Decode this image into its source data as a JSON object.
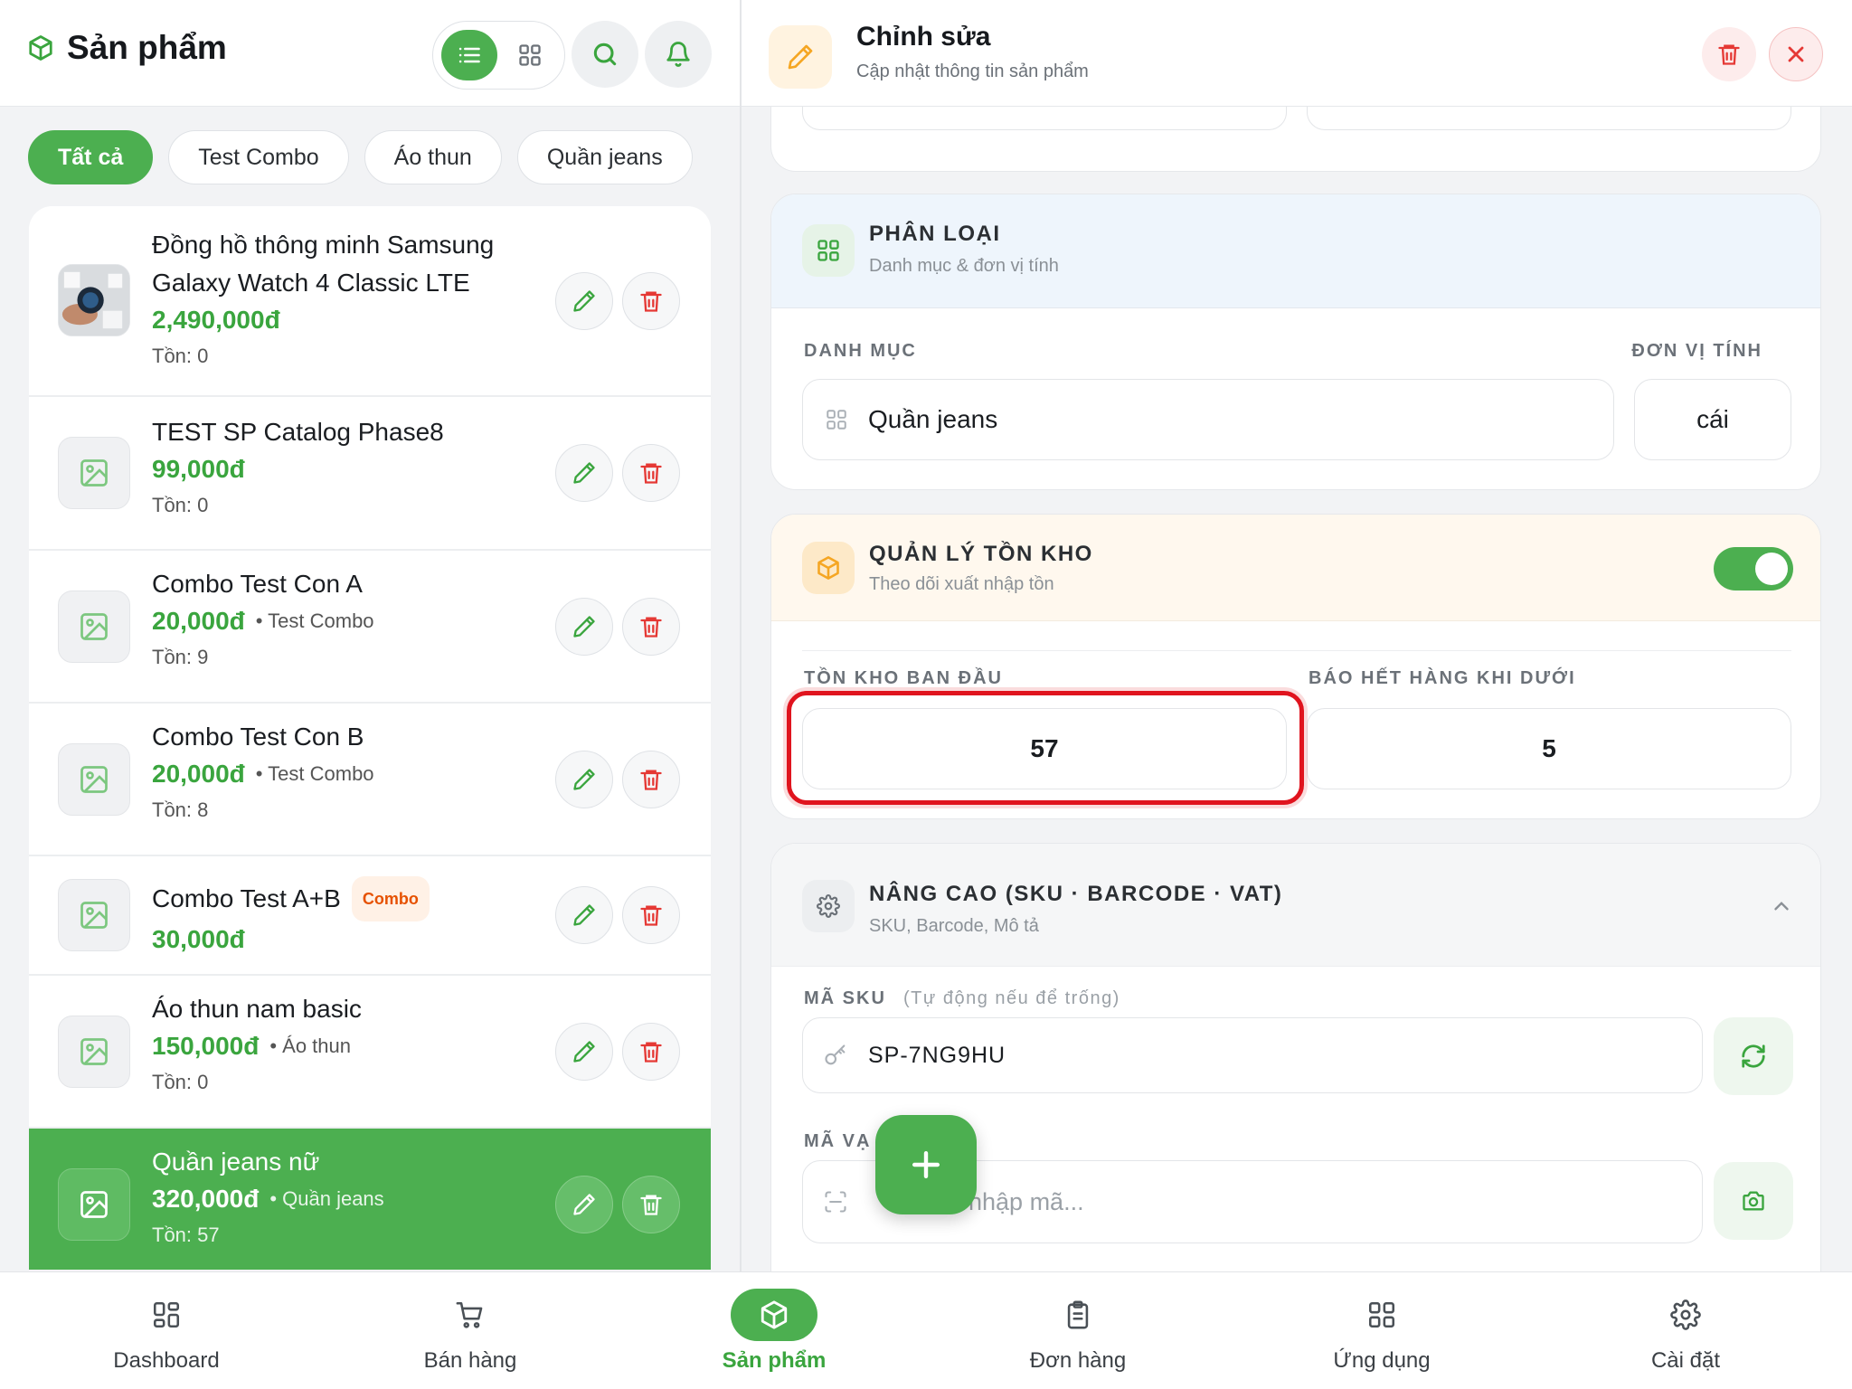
{
  "left": {
    "title": "Sản phẩm",
    "chips": [
      "Tất cả",
      "Test Combo",
      "Áo thun",
      "Quần jeans"
    ],
    "products": [
      {
        "name": "Đồng hồ thông minh Samsung Galaxy Watch 4 Classic LTE",
        "price": "2,490,000đ",
        "category": "",
        "stock": "Tồn: 0",
        "badge": ""
      },
      {
        "name": "TEST SP Catalog Phase8",
        "price": "99,000đ",
        "category": "",
        "stock": "Tồn: 0",
        "badge": ""
      },
      {
        "name": "Combo Test Con A",
        "price": "20,000đ",
        "category": "• Test Combo",
        "stock": "Tồn: 9",
        "badge": ""
      },
      {
        "name": "Combo Test Con B",
        "price": "20,000đ",
        "category": "• Test Combo",
        "stock": "Tồn: 8",
        "badge": ""
      },
      {
        "name": "Combo Test A+B",
        "price": "30,000đ",
        "category": "",
        "stock": "",
        "badge": "Combo"
      },
      {
        "name": "Áo thun nam basic",
        "price": "150,000đ",
        "category": "• Áo thun",
        "stock": "Tồn: 0",
        "badge": ""
      },
      {
        "name": "Quần jeans nữ",
        "price": "320,000đ",
        "category": "• Quần jeans",
        "stock": "Tồn: 57",
        "badge": ""
      }
    ]
  },
  "right": {
    "title": "Chỉnh sửa",
    "subtitle": "Cập nhật thông tin sản phẩm",
    "classification": {
      "title": "PHÂN LOẠI",
      "subtitle": "Danh mục & đơn vị tính",
      "category_label": "DANH MỤC",
      "unit_label": "ĐƠN VỊ TÍNH",
      "category_value": "Quần jeans",
      "unit_value": "cái"
    },
    "inventory": {
      "title": "QUẢN LÝ TỒN KHO",
      "subtitle": "Theo dõi xuất nhập tồn",
      "enabled": true,
      "initial_label": "TỒN KHO BAN ĐẦU",
      "alert_label": "BÁO HẾT HÀNG KHI DƯỚI",
      "initial_value": "57",
      "alert_value": "5"
    },
    "advanced": {
      "title": "NÂNG CAO (SKU · BARCODE · VAT)",
      "subtitle": "SKU, Barcode, Mô tả",
      "sku_label": "MÃ SKU",
      "sku_hint": "(Tự động nếu để trống)",
      "sku_value": "SP-7NG9HU",
      "barcode_label_visible": "MÃ VẠ",
      "barcode_placeholder_visible": "c nhập mã..."
    }
  },
  "nav": [
    "Dashboard",
    "Bán hàng",
    "Sản phẩm",
    "Đơn hàng",
    "Ứng dụng",
    "Cài đặt"
  ],
  "colors": {
    "primary": "#4caf50",
    "danger": "#e53935",
    "warning": "#f5a623",
    "highlight": "#e0141e"
  }
}
